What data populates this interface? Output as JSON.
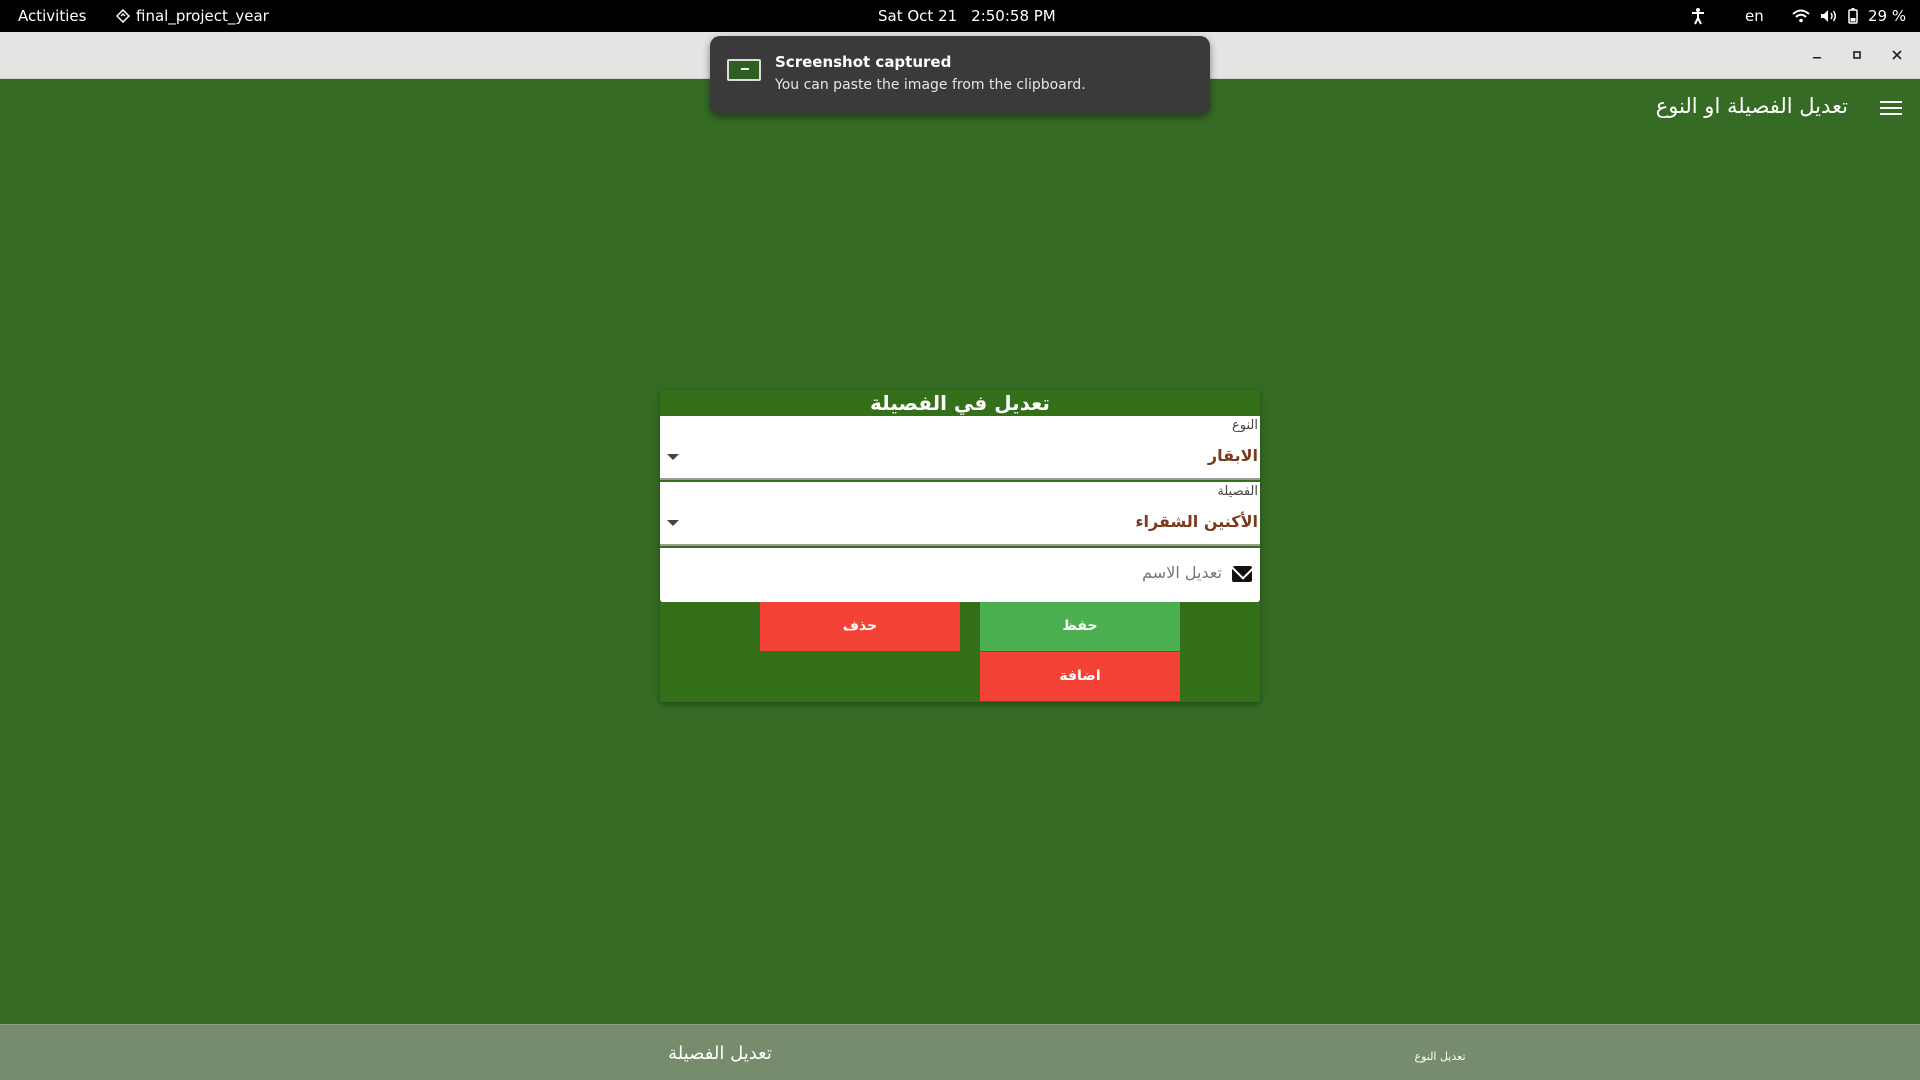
{
  "topbar": {
    "activities": "Activities",
    "app_name": "final_project_year",
    "date": "Sat Oct 21",
    "time": "2:50:58 PM",
    "language": "en",
    "battery": "29 %"
  },
  "notification": {
    "title": "Screenshot captured",
    "body": "You can paste the image from the clipboard."
  },
  "appbar": {
    "title": "تعديل الفصيلة او النوع"
  },
  "card": {
    "title": "تعديل في الفصيلة",
    "type_dropdown": {
      "label": "النوع",
      "value": "الابقار"
    },
    "family_dropdown": {
      "label": "الفصيلة",
      "value": "الأكنين الشقراء"
    },
    "name_field": {
      "placeholder": "تعديل الاسم",
      "value": ""
    },
    "buttons": {
      "delete": "حذف",
      "save": "حفظ",
      "add": "اضافة"
    }
  },
  "bottom_nav": {
    "tabs": [
      {
        "label": "تعديل الفصيلة"
      },
      {
        "label": "تعديل النوع"
      }
    ]
  },
  "colors": {
    "background": "#356b24",
    "card": "#337019",
    "save": "#4caf50",
    "danger": "#f44336",
    "bottom_nav": "#778c6c",
    "dropdown_value": "#7a3b1c"
  }
}
